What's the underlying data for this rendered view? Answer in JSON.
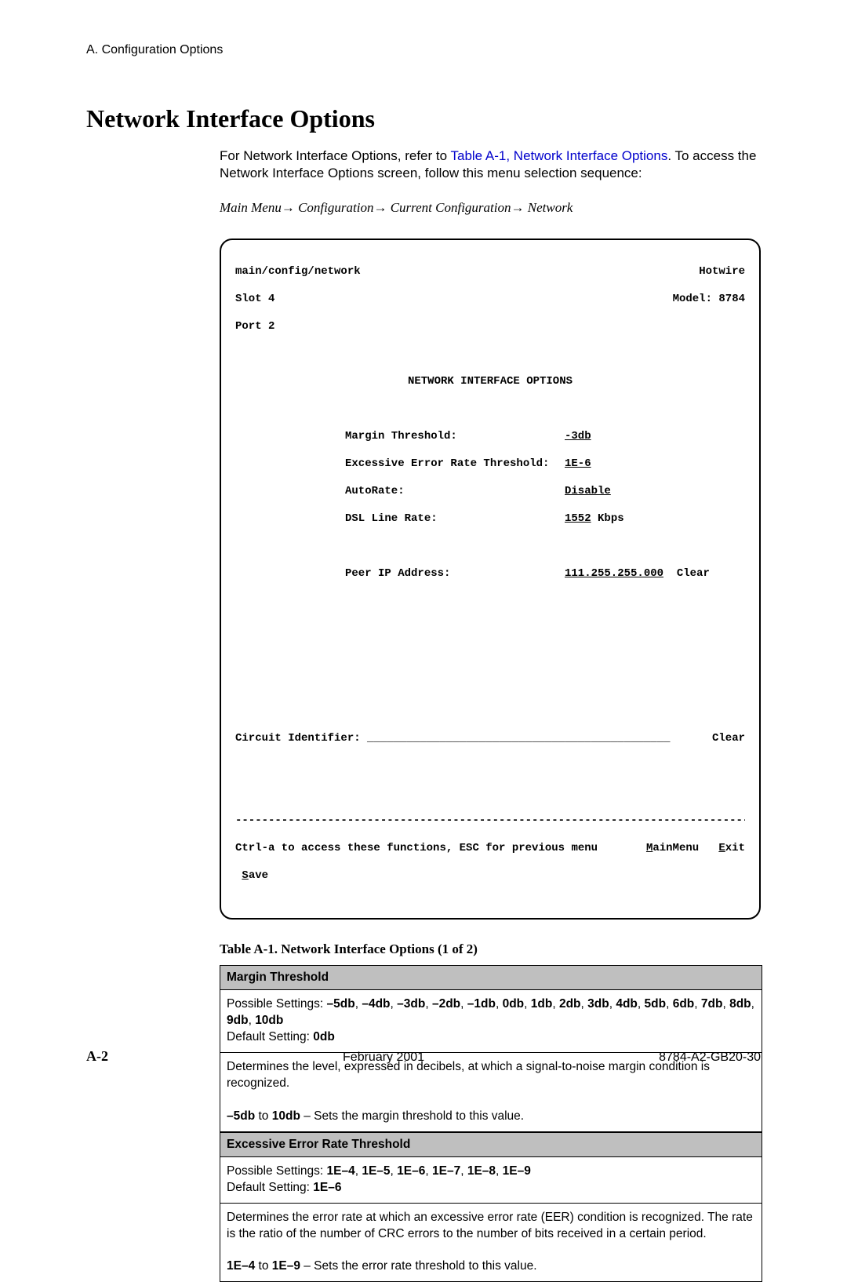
{
  "header": {
    "breadcrumb": "A. Configuration Options"
  },
  "title": "Network Interface Options",
  "intro": {
    "pre_link": "For Network Interface Options, refer to ",
    "link": "Table A-1, Network Interface Options",
    "post_link": ". To access the Network Interface Options screen, follow this menu selection sequence:",
    "nav_path": "Main Menu→ Configuration→ Current Configuration→ Network"
  },
  "terminal": {
    "path": "main/config/network",
    "brand": "Hotwire",
    "slot": "Slot 4",
    "model": "Model: 8784",
    "port": "Port 2",
    "title": "NETWORK INTERFACE OPTIONS",
    "opts": [
      {
        "label": "Margin Threshold:",
        "value": "-3db",
        "suffix": ""
      },
      {
        "label": "Excessive Error Rate Threshold:",
        "value": "1E-6",
        "suffix": ""
      },
      {
        "label": "AutoRate:",
        "value": "Disable",
        "suffix": ""
      },
      {
        "label": "DSL Line Rate:",
        "value": "1552",
        "suffix": " Kbps"
      }
    ],
    "peer_label": "Peer IP Address:",
    "peer_value": "111.255.255.000",
    "peer_clear": "Clear",
    "circuit_label": "Circuit Identifier:",
    "circuit_clear": "Clear",
    "help": "Ctrl-a to access these functions, ESC for previous menu",
    "main_menu": "MainMenu",
    "exit": "Exit",
    "save": "Save"
  },
  "caption": "Table A-1.   Network Interface Options (1 of 2)",
  "table": {
    "sections": [
      {
        "header": "Margin Threshold",
        "cells": [
          "Possible Settings: <b>–5db</b>, <b>–4db</b>, <b>–3db</b>, <b>–2db</b>, <b>–1db</b>, <b>0db</b>, <b>1db</b>, <b>2db</b>, <b>3db</b>, <b>4db</b>, <b>5db</b>, <b>6db</b>, <b>7db</b>, <b>8db</b>, <b>9db</b>, <b>10db</b><br>Default Setting: <b>0db</b>",
          "Determines the level, expressed in decibels, at which a signal-to-noise margin condition is recognized.<br><br><b>–5db</b> to <b>10db</b> – Sets the margin threshold to this value."
        ]
      },
      {
        "header": "Excessive Error Rate Threshold",
        "cells": [
          "Possible Settings: <b>1E–4</b>, <b>1E–5</b>, <b>1E–6</b>, <b>1E–7</b>, <b>1E–8</b>, <b>1E–9</b><br>Default Setting: <b>1E–6</b>",
          "Determines the error rate at which an excessive error rate (EER) condition is recognized. The rate is the ratio of the number of CRC errors to the number of bits received in a certain period.<br><br><b>1E–4</b> to <b>1E–9</b> – Sets the error rate threshold to this value."
        ]
      }
    ]
  },
  "footer": {
    "page_num": "A-2",
    "date": "February 2001",
    "doc_id": "8784-A2-GB20-30"
  }
}
